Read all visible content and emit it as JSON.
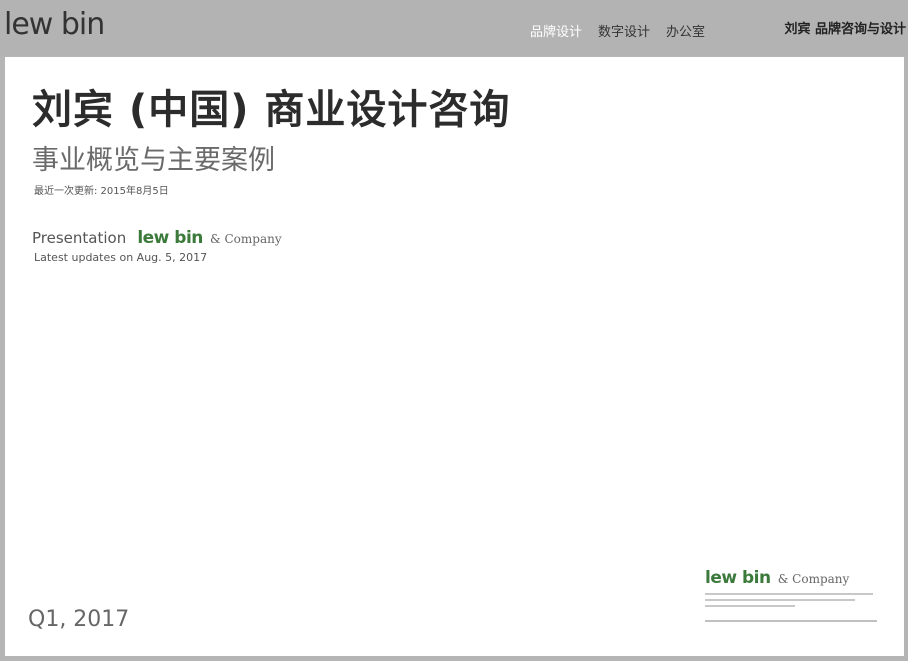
{
  "header": {
    "logo": "lew bin",
    "nav": [
      "品牌设计",
      "数字设计",
      "办公室"
    ],
    "tagline": "刘宾  品牌咨询与设计"
  },
  "slide": {
    "title": "刘宾 (中国) 商业设计咨询",
    "subtitle": "事业概览与主要案例",
    "updated_cn": "最近一次更新: 2015年8月5日",
    "presentation_label": "Presentation",
    "brand": "lew bin",
    "company": "& Company",
    "updated_en": "Latest updates on Aug. 5, 2017",
    "quarter": "Q1, 2017",
    "footer_brand": "lew bin",
    "footer_company": "& Company"
  },
  "colors": {
    "background": "#b5b5b5",
    "slide": "#ffffff",
    "brand_green": "#3b7a3b",
    "active_nav": "#ffffff"
  }
}
